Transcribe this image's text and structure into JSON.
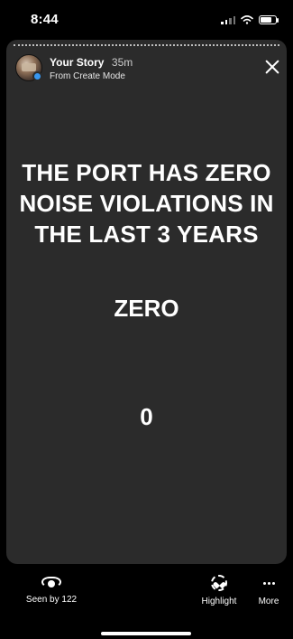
{
  "status_bar": {
    "time": "8:44"
  },
  "story": {
    "title": "Your Story",
    "age": "35m",
    "subtitle": "From Create Mode",
    "headline_lines": [
      "THE PORT HAS ZERO",
      "NOISE VIOLATIONS IN",
      "THE LAST 3 YEARS"
    ],
    "zero_word": "ZERO",
    "zero_digit": "0"
  },
  "bottom": {
    "seen_label": "Seen by 122",
    "highlight_label": "Highlight",
    "more_label": "More"
  },
  "icons": {
    "avatar": "avatar-icon",
    "close": "close-icon",
    "seen": "eye-icon",
    "highlight": "highlight-icon",
    "more": "more-icon"
  },
  "colors": {
    "story_background": "#2b2b2b",
    "app_background": "#000000",
    "accent_badge": "#3897f0"
  }
}
